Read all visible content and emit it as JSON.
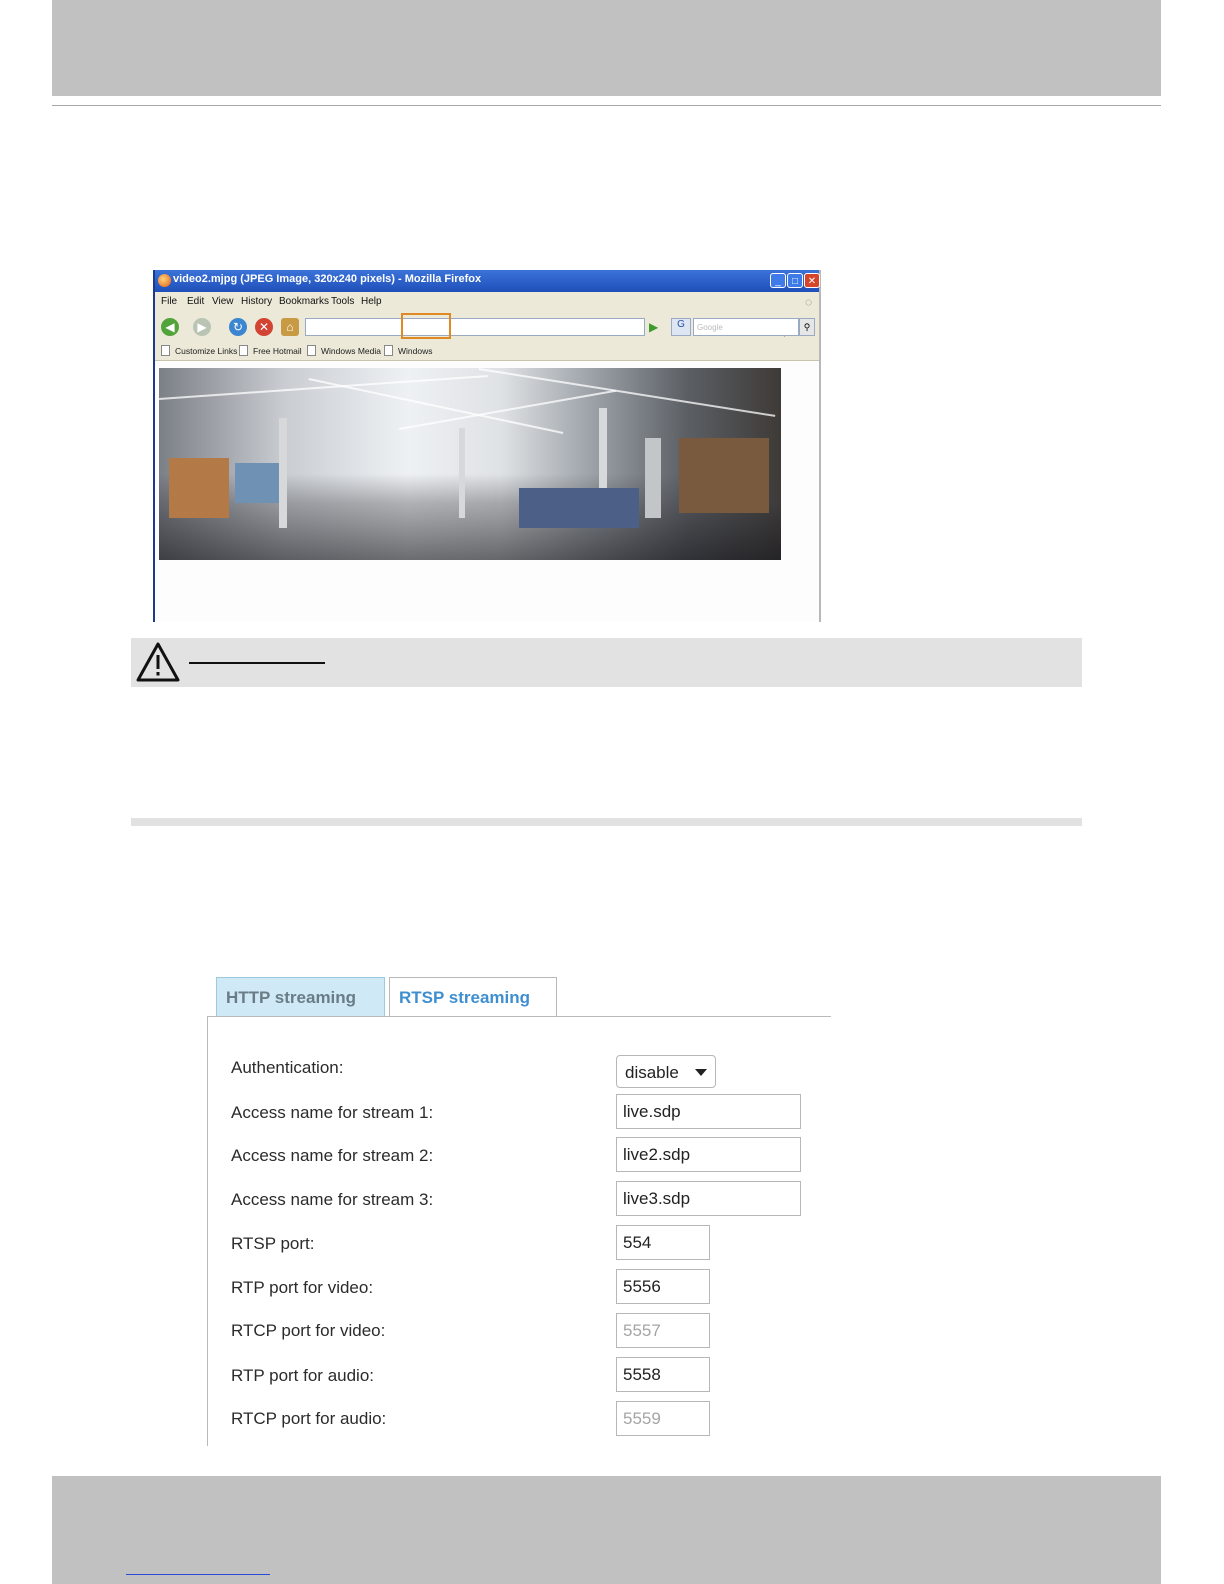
{
  "firefox": {
    "title": "video2.mjpg (JPEG Image, 320x240 pixels) - Mozilla Firefox",
    "menu": [
      "File",
      "Edit",
      "View",
      "History",
      "Bookmarks",
      "Tools",
      "Help"
    ],
    "search_placeholder": "Google",
    "bookmarks": [
      "Customize Links",
      "Free Hotmail",
      "Windows Media",
      "Windows"
    ]
  },
  "rtsp_panel": {
    "tabs": [
      "HTTP streaming",
      "RTSP streaming"
    ],
    "active_tab": "RTSP streaming",
    "fields": [
      {
        "label": "Authentication:",
        "value": "disable",
        "type": "select"
      },
      {
        "label": "Access name for stream 1:",
        "value": "live.sdp"
      },
      {
        "label": "Access name for stream 2:",
        "value": "live2.sdp"
      },
      {
        "label": "Access name for stream 3:",
        "value": "live3.sdp"
      },
      {
        "label": "RTSP port:",
        "value": "554"
      },
      {
        "label": "RTP port for video:",
        "value": "5556"
      },
      {
        "label": "RTCP port for video:",
        "value": "5557",
        "disabled": true
      },
      {
        "label": "RTP port for audio:",
        "value": "5558"
      },
      {
        "label": "RTCP port for audio:",
        "value": "5559",
        "disabled": true
      }
    ]
  },
  "colors": {
    "band_gray": "#c1c1c1",
    "note_gray": "#e2e2e2",
    "tab_active_text": "#3f8fd0",
    "caution_border": "#e08a25"
  },
  "icons": [
    "caution-triangle-icon",
    "firefox-icon",
    "back-arrow-icon",
    "forward-arrow-icon",
    "reload-icon",
    "stop-icon",
    "home-icon",
    "go-arrow-icon",
    "search-icon",
    "dropdown-caret-icon"
  ]
}
